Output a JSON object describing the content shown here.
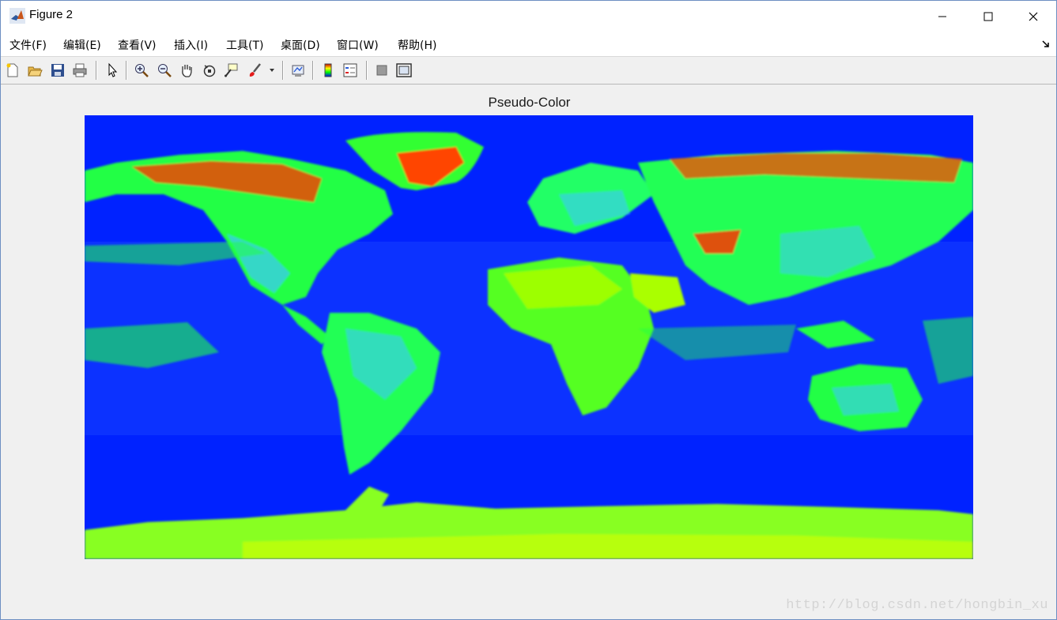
{
  "window": {
    "title": "Figure 2",
    "controls": {
      "minimize_icon": "minimize-icon",
      "maximize_icon": "maximize-icon",
      "close_icon": "close-icon"
    }
  },
  "menubar": {
    "items": [
      {
        "label": "文件(F)"
      },
      {
        "label": "编辑(E)"
      },
      {
        "label": "查看(V)"
      },
      {
        "label": "插入(I)"
      },
      {
        "label": "工具(T)"
      },
      {
        "label": "桌面(D)"
      },
      {
        "label": "窗口(W)"
      },
      {
        "label": "帮助(H)"
      }
    ]
  },
  "toolbar": {
    "buttons": [
      "new-figure-icon",
      "open-file-icon",
      "save-icon",
      "print-icon",
      "select-arrow-icon",
      "zoom-in-icon",
      "zoom-out-icon",
      "pan-hand-icon",
      "rotate-3d-icon",
      "data-cursor-icon",
      "brush-icon",
      "link-plot-icon",
      "colorbar-icon",
      "legend-icon",
      "hide-plot-tools-icon",
      "show-plot-tools-icon"
    ]
  },
  "axes": {
    "title": "Pseudo-Color",
    "colormap": "jet",
    "colors": {
      "ocean": "#0022ff",
      "land_low": "#00ff40",
      "land_mid": "#b0ff00",
      "land_high": "#ff3300"
    }
  },
  "watermark": "http://blog.csdn.net/hongbin_xu"
}
